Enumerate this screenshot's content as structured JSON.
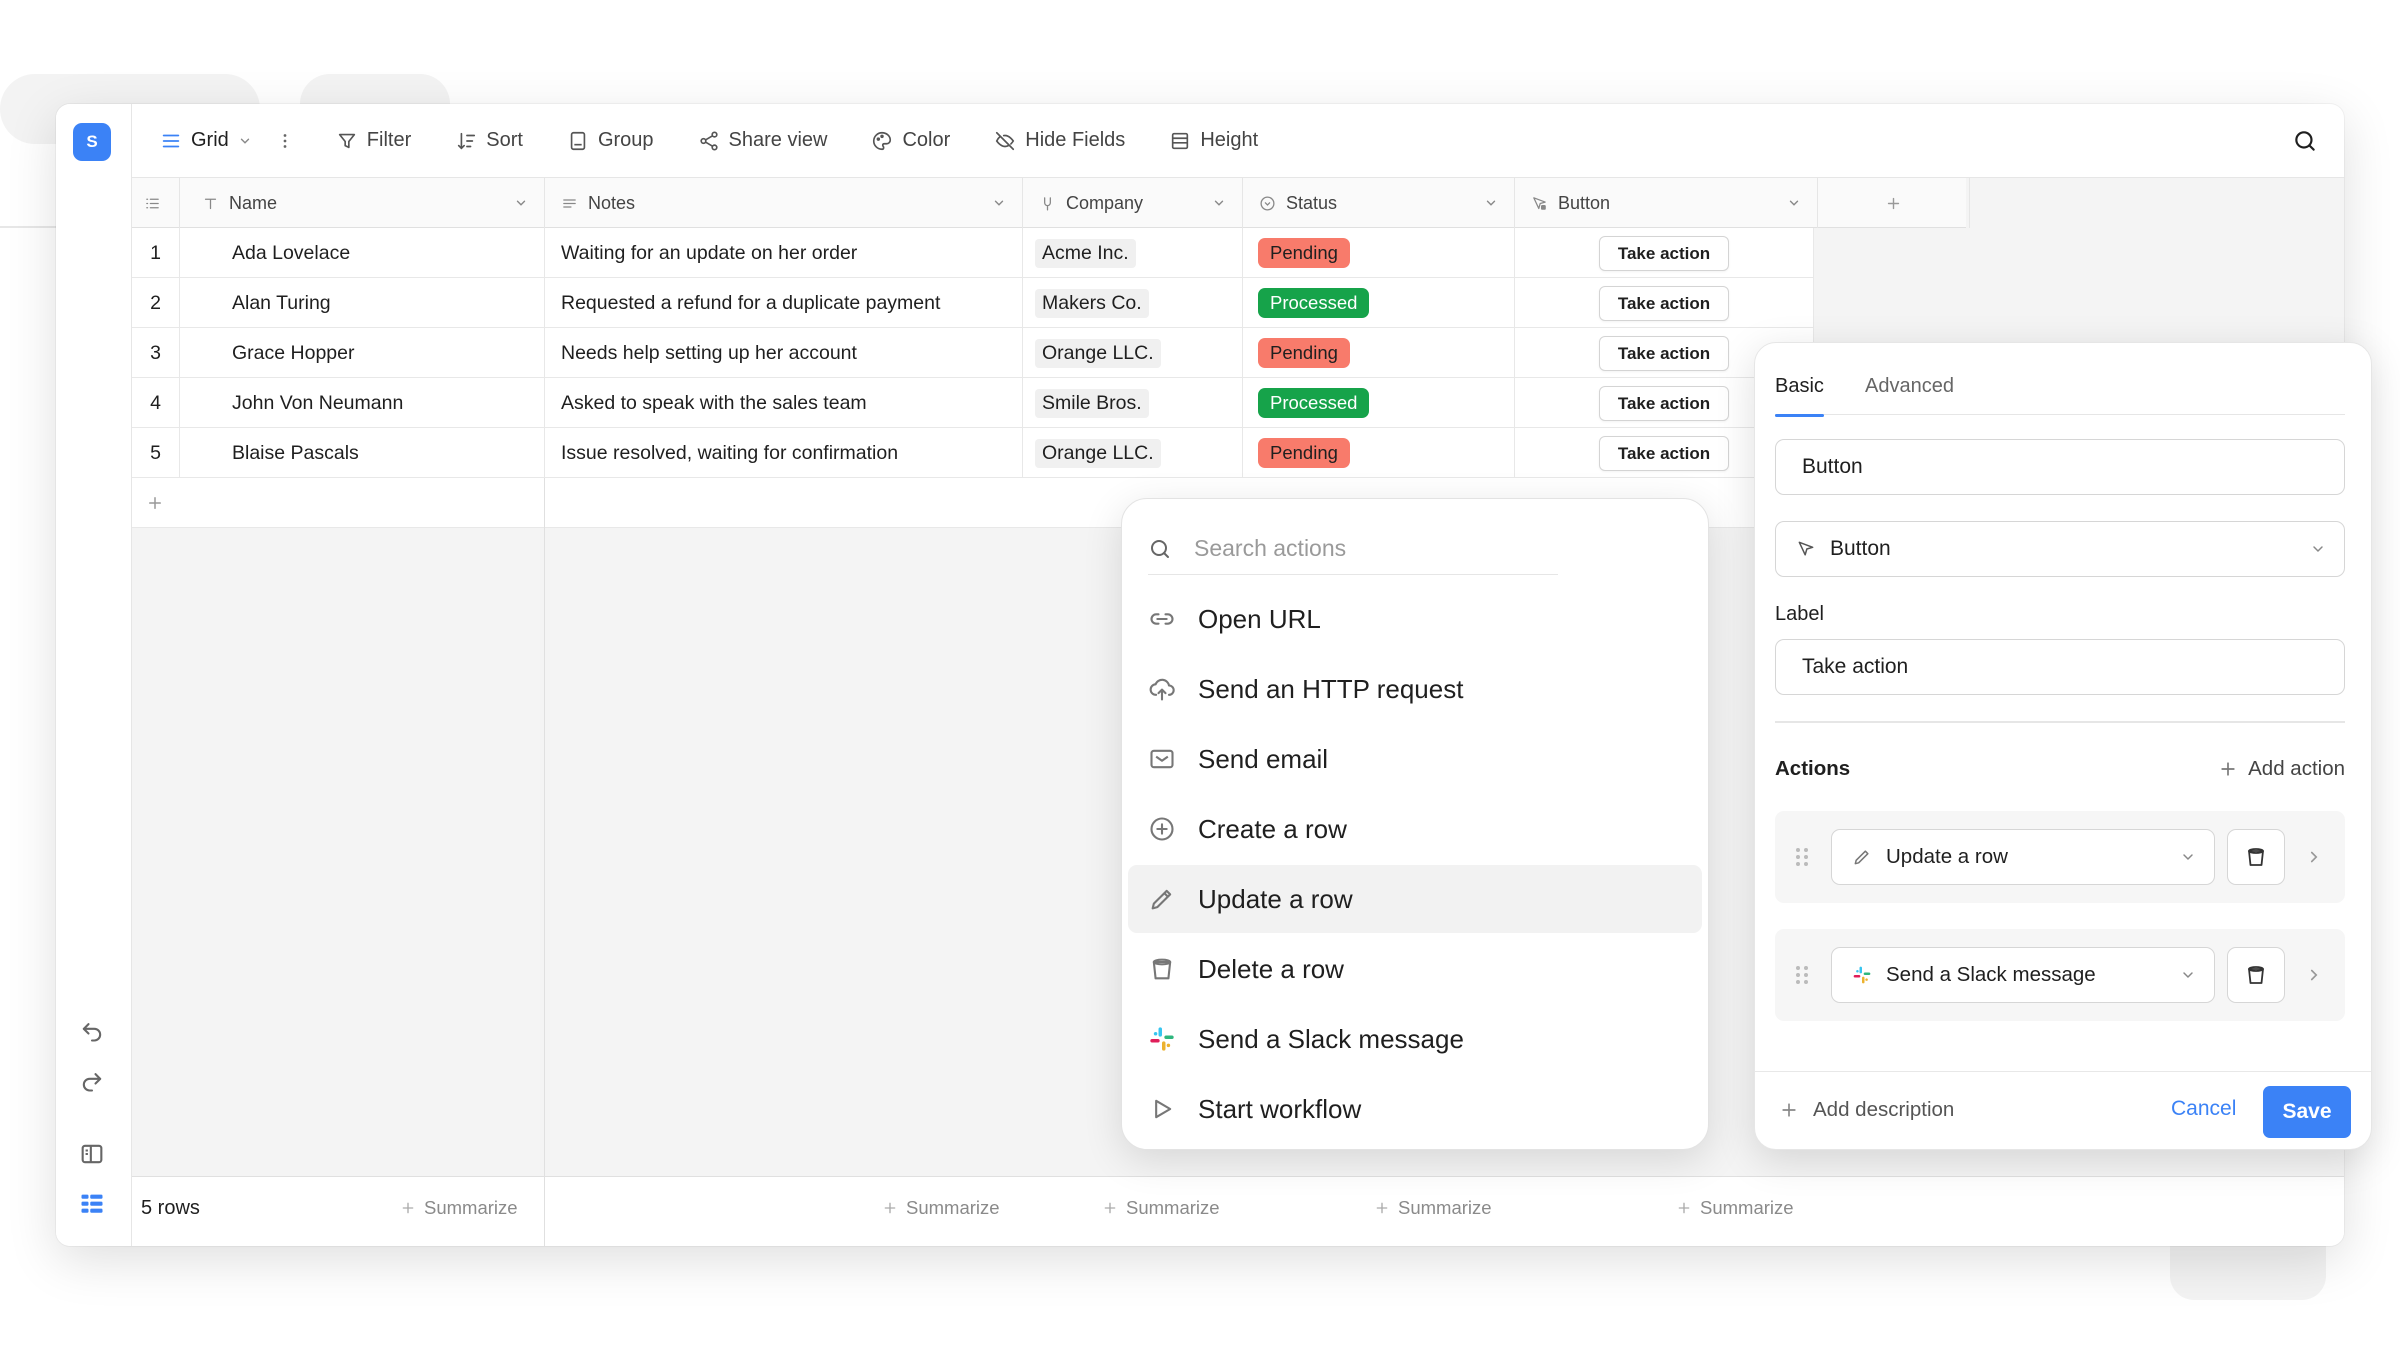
{
  "app": {
    "logo_letter": "S",
    "accent_color": "#3b82f6"
  },
  "toolbar": {
    "view_name": "Grid",
    "items": [
      "Filter",
      "Sort",
      "Group",
      "Share view",
      "Color",
      "Hide Fields",
      "Height"
    ]
  },
  "columns": [
    "Name",
    "Notes",
    "Company",
    "Status",
    "Button"
  ],
  "rows": [
    {
      "num": "1",
      "name": "Ada Lovelace",
      "notes": "Waiting for an update on her order",
      "company": "Acme Inc.",
      "status": "Pending",
      "button": "Take action"
    },
    {
      "num": "2",
      "name": "Alan Turing",
      "notes": "Requested a refund for a duplicate payment",
      "company": "Makers Co.",
      "status": "Processed",
      "button": "Take action"
    },
    {
      "num": "3",
      "name": "Grace Hopper",
      "notes": "Needs help setting up her account",
      "company": "Orange LLC.",
      "status": "Pending",
      "button": "Take action"
    },
    {
      "num": "4",
      "name": "John Von Neumann",
      "notes": "Asked to speak with the sales team",
      "company": "Smile Bros.",
      "status": "Processed",
      "button": "Take action"
    },
    {
      "num": "5",
      "name": "Blaise Pascals",
      "notes": "Issue resolved, waiting for confirmation",
      "company": "Orange LLC.",
      "status": "Pending",
      "button": "Take action"
    }
  ],
  "status_colors": {
    "Pending": "#f87b6b",
    "Processed": "#16a34a"
  },
  "footer": {
    "row_count": "5 rows",
    "summarize_label": "Summarize"
  },
  "dropdown": {
    "search_placeholder": "Search actions",
    "items": [
      "Open URL",
      "Send an HTTP request",
      "Send email",
      "Create a row",
      "Update a row",
      "Delete a row",
      "Send a Slack message",
      "Start workflow"
    ],
    "active_item": "Update a row"
  },
  "panel": {
    "tabs": [
      "Basic",
      "Advanced"
    ],
    "field_name": "Button",
    "field_type": "Button",
    "label_title": "Label",
    "label_value": "Take action",
    "actions_title": "Actions",
    "add_action": "Add action",
    "actions": [
      "Update a row",
      "Send a Slack message"
    ],
    "add_description": "Add description",
    "cancel": "Cancel",
    "save": "Save"
  }
}
